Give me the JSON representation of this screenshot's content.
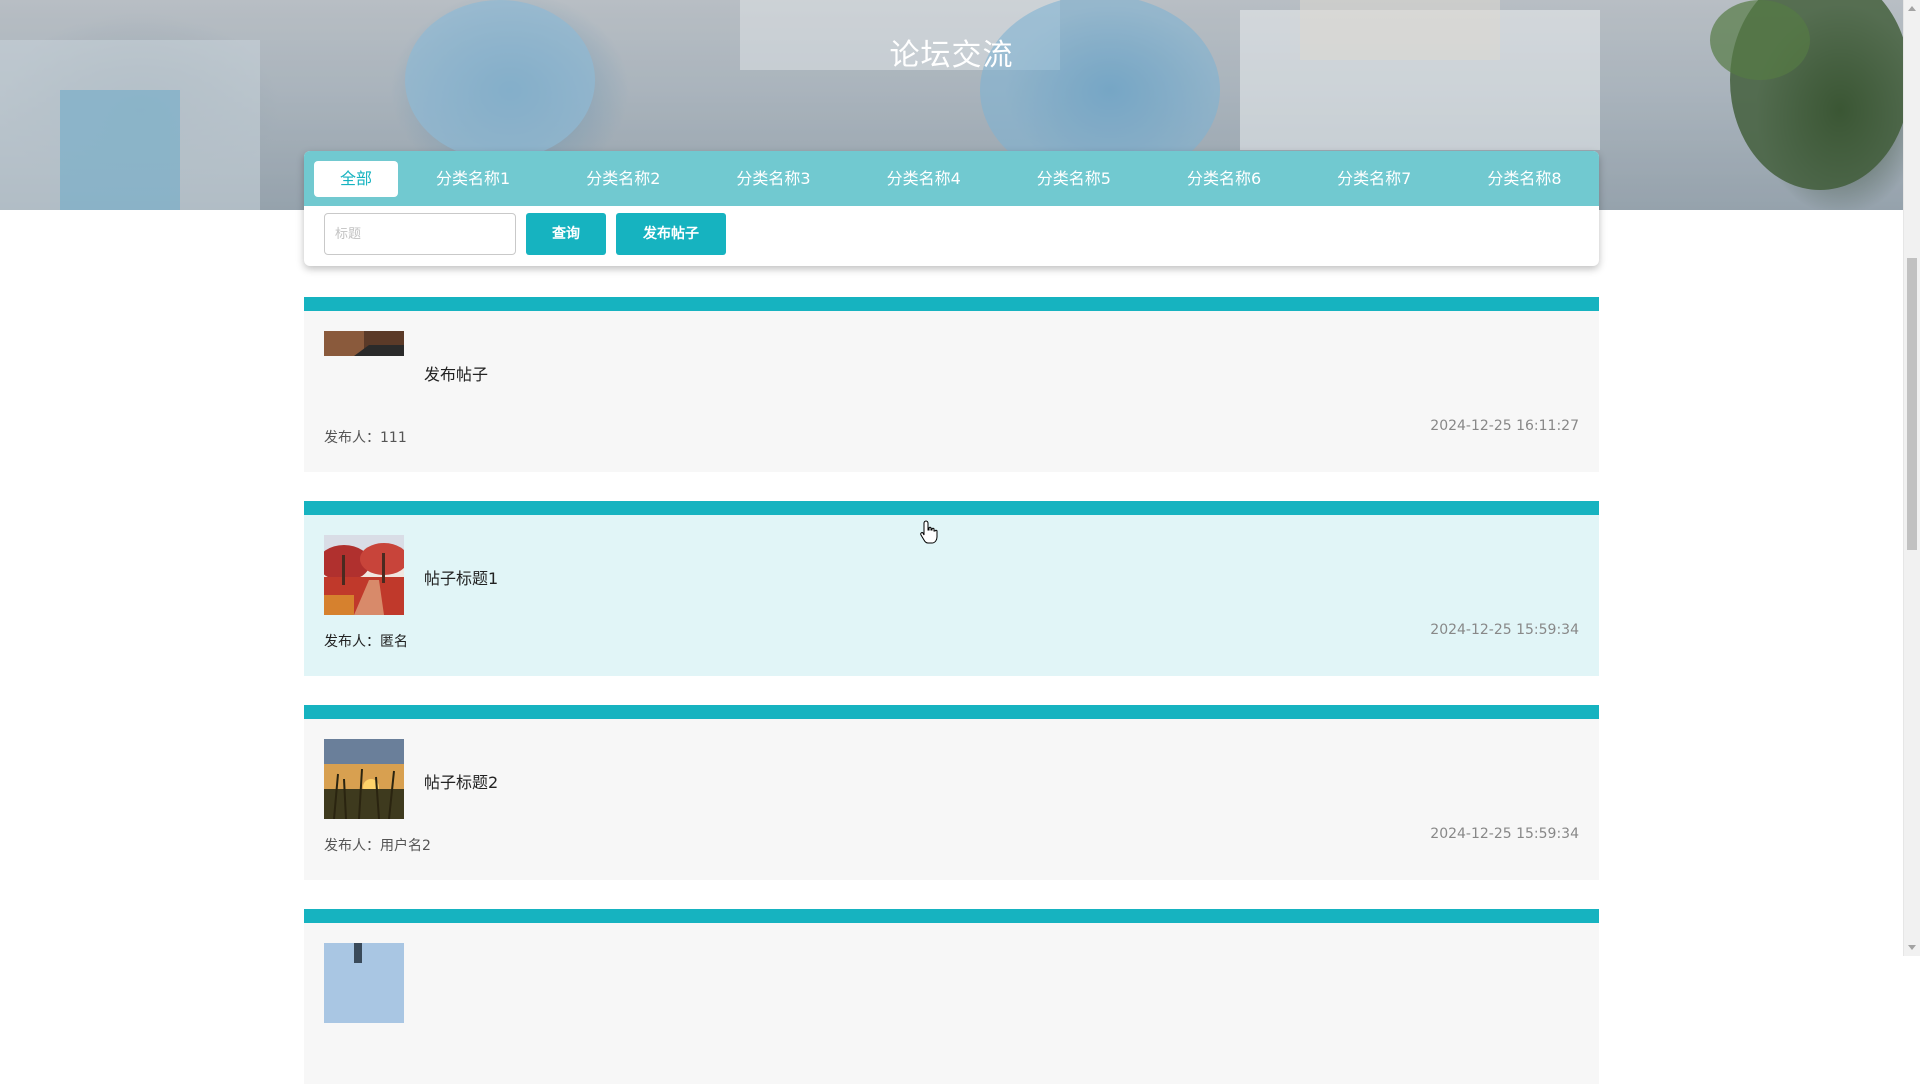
{
  "hero": {
    "title": "论坛交流"
  },
  "tabs": [
    {
      "label": "全部",
      "active": true
    },
    {
      "label": "分类名称1"
    },
    {
      "label": "分类名称2"
    },
    {
      "label": "分类名称3"
    },
    {
      "label": "分类名称4"
    },
    {
      "label": "分类名称5"
    },
    {
      "label": "分类名称6"
    },
    {
      "label": "分类名称7"
    },
    {
      "label": "分类名称8"
    }
  ],
  "search": {
    "placeholder": "标题",
    "value": ""
  },
  "buttons": {
    "search_label": "查询",
    "publish_label": "发布帖子"
  },
  "posts": [
    {
      "title": "发布帖子",
      "author": "发布人：111",
      "time": "2024-12-25 16:11:27",
      "thumb": "dark-photo"
    },
    {
      "title": "帖子标题1",
      "author": "发布人：匿名",
      "time": "2024-12-25 15:59:34",
      "thumb": "red-autumn-trees"
    },
    {
      "title": "帖子标题2",
      "author": "发布人：用户名2",
      "time": "2024-12-25 15:59:34",
      "thumb": "sunset-grass"
    }
  ],
  "colors": {
    "accent": "#16b3c0",
    "tabbar": "#71c9d0",
    "card_bg": "#f7f7f7",
    "card_hover_bg": "#e1f5f7"
  }
}
